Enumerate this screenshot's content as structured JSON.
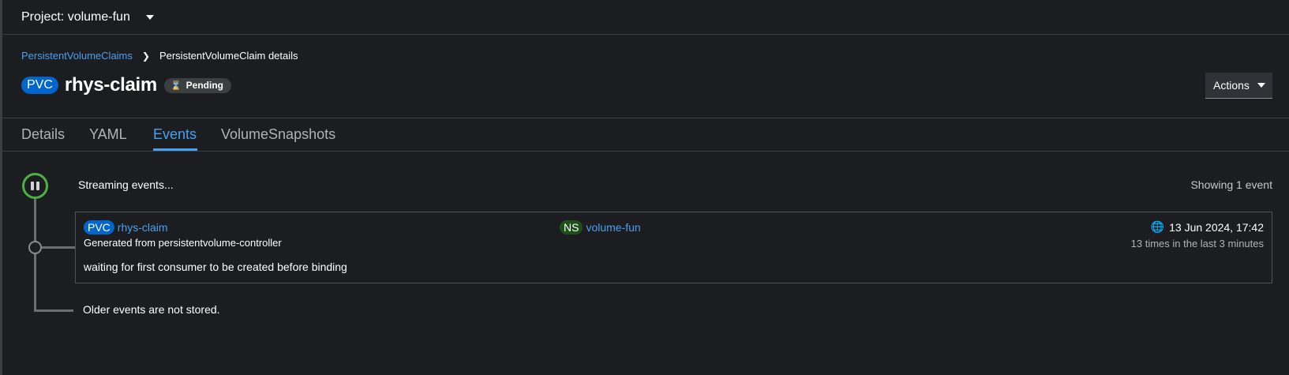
{
  "project": {
    "label": "Project: volume-fun"
  },
  "breadcrumb": {
    "parent": "PersistentVolumeClaims",
    "current": "PersistentVolumeClaim details"
  },
  "header": {
    "kind_badge": "PVC",
    "title": "rhys-claim",
    "status": "Pending",
    "status_icon": "hourglass-icon",
    "actions_label": "Actions"
  },
  "tabs": [
    {
      "label": "Details",
      "active": false
    },
    {
      "label": "YAML",
      "active": false
    },
    {
      "label": "Events",
      "active": true
    },
    {
      "label": "VolumeSnapshots",
      "active": false
    }
  ],
  "events": {
    "streaming_text": "Streaming events...",
    "showing_text": "Showing 1 event",
    "items": [
      {
        "kind_badge": "PVC",
        "resource": "rhys-claim",
        "ns_badge": "NS",
        "namespace": "volume-fun",
        "source": "Generated from persistentvolume-controller",
        "timestamp": "13 Jun 2024, 17:42",
        "count_text": "13 times in the last 3 minutes",
        "message": "waiting for first consumer to be created before binding"
      }
    ],
    "older_text": "Older events are not stored."
  },
  "colors": {
    "accent": "#4aa0f0",
    "pvc_badge": "#0066cc",
    "ns_badge": "#1e4f18",
    "stream_ring": "#4cb140",
    "background": "#1b1d21"
  }
}
